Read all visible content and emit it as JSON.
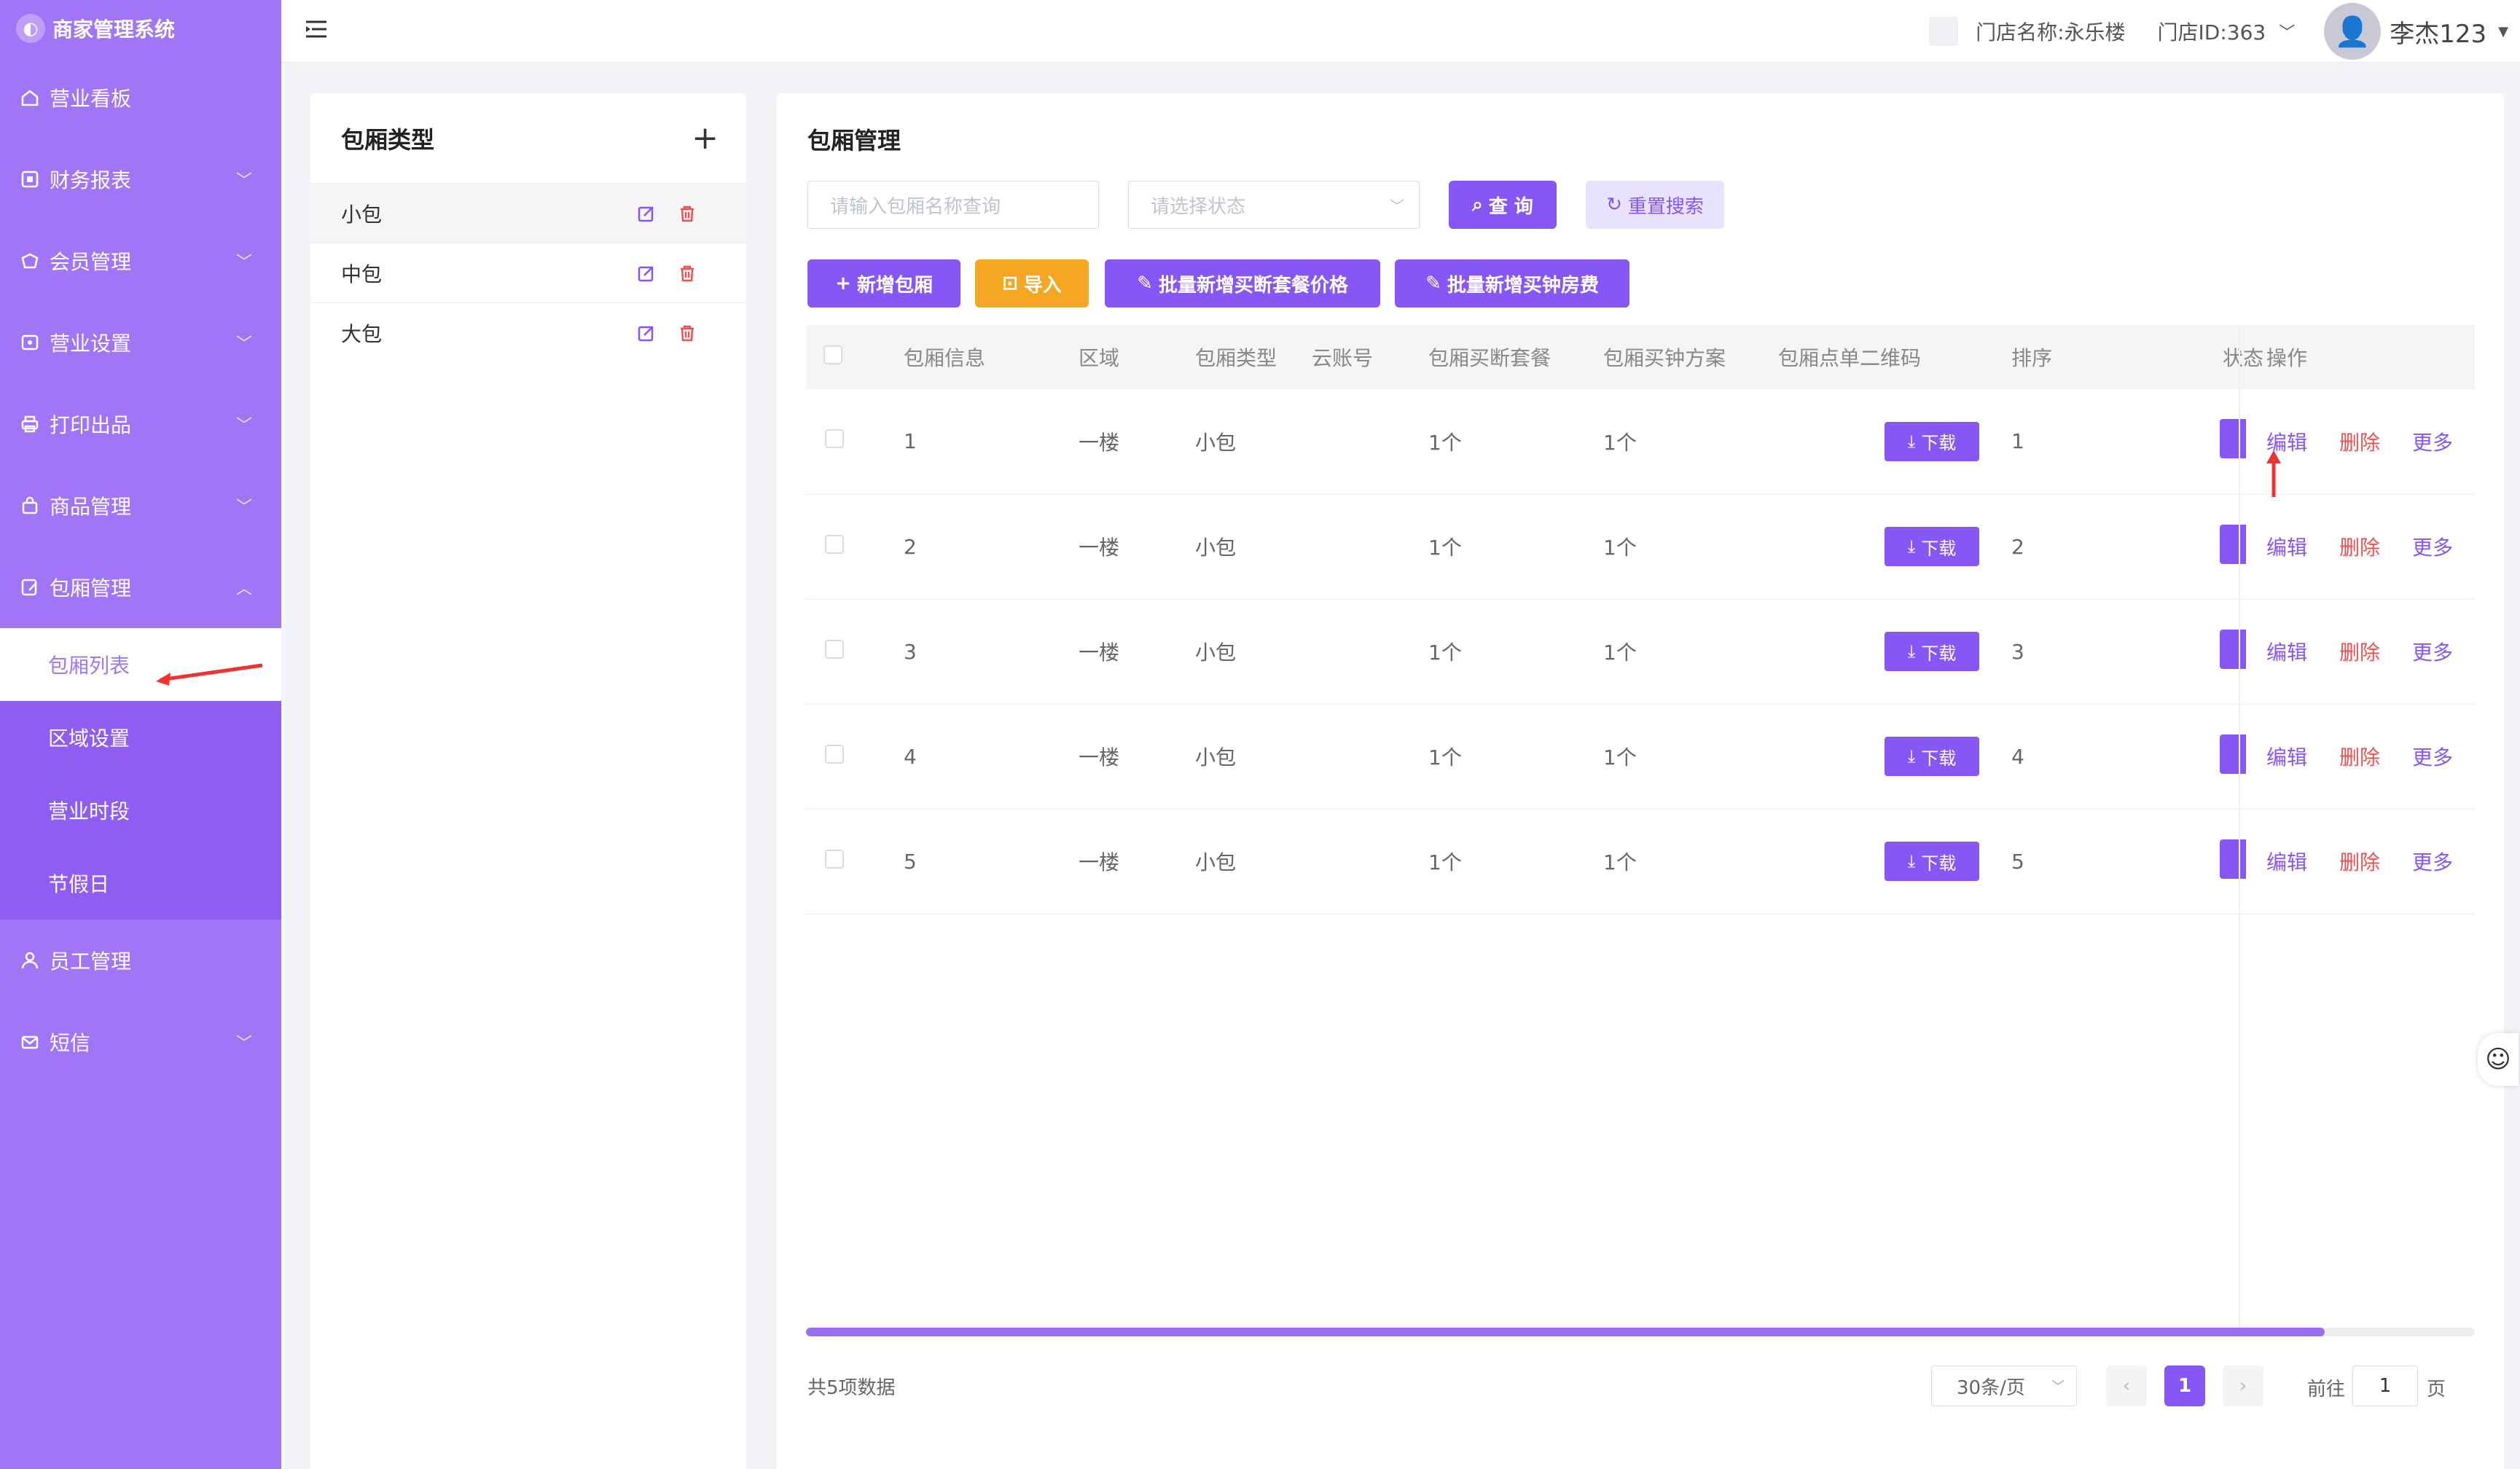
{
  "app": {
    "brand": "商家管理系统"
  },
  "sidebar": {
    "items": [
      {
        "label": "营业看板",
        "icon": "home-icon",
        "has_chevron": false
      },
      {
        "label": "财务报表",
        "icon": "report-icon",
        "has_chevron": true
      },
      {
        "label": "会员管理",
        "icon": "member-icon",
        "has_chevron": true
      },
      {
        "label": "营业设置",
        "icon": "settings-icon",
        "has_chevron": true
      },
      {
        "label": "打印出品",
        "icon": "printer-icon",
        "has_chevron": true
      },
      {
        "label": "商品管理",
        "icon": "bag-icon",
        "has_chevron": true
      },
      {
        "label": "包厢管理",
        "icon": "room-icon",
        "has_chevron": true,
        "expanded": true
      },
      {
        "label": "员工管理",
        "icon": "user-icon",
        "has_chevron": false
      },
      {
        "label": "短信",
        "icon": "mail-icon",
        "has_chevron": true
      }
    ],
    "submenu": [
      "包厢列表",
      "区域设置",
      "营业时段",
      "节假日"
    ],
    "active_sub": "包厢列表"
  },
  "topbar": {
    "store_name": "门店名称:永乐楼",
    "store_id": "门店ID:363",
    "user_name": "李杰123"
  },
  "left_panel": {
    "title": "包厢类型",
    "add_symbol": "+",
    "types": [
      "小包",
      "中包",
      "大包"
    ]
  },
  "main": {
    "title": "包厢管理",
    "search_placeholder": "请输入包厢名称查询",
    "status_placeholder": "请选择状态",
    "query_label": "查 询",
    "reset_label": "重置搜索",
    "add_label": "新增包厢",
    "import_label": "导入",
    "batch_price_label": "批量新增买断套餐价格",
    "batch_clock_label": "批量新增买钟房费",
    "columns": [
      "包厢信息",
      "区域",
      "包厢类型",
      "云账号",
      "包厢买断套餐",
      "包厢买钟方案",
      "包厢点单二维码",
      "排序",
      "状态",
      "操作"
    ],
    "rows": [
      {
        "info": "1",
        "area": "一楼",
        "type": "小包",
        "cloud": "",
        "buyout": "1个",
        "clock": "1个",
        "qr": "下载",
        "sort": "1"
      },
      {
        "info": "2",
        "area": "一楼",
        "type": "小包",
        "cloud": "",
        "buyout": "1个",
        "clock": "1个",
        "qr": "下载",
        "sort": "2"
      },
      {
        "info": "3",
        "area": "一楼",
        "type": "小包",
        "cloud": "",
        "buyout": "1个",
        "clock": "1个",
        "qr": "下载",
        "sort": "3"
      },
      {
        "info": "4",
        "area": "一楼",
        "type": "小包",
        "cloud": "",
        "buyout": "1个",
        "clock": "1个",
        "qr": "下载",
        "sort": "4"
      },
      {
        "info": "5",
        "area": "一楼",
        "type": "小包",
        "cloud": "",
        "buyout": "1个",
        "clock": "1个",
        "qr": "下载",
        "sort": "5"
      }
    ],
    "row_actions": {
      "edit": "编辑",
      "delete": "删除",
      "more": "更多"
    },
    "total_text": "共5项数据",
    "page_size": "30条/页",
    "current_page": "1",
    "goto_prefix": "前往",
    "goto_value": "1",
    "goto_suffix": "页",
    "horizontal_scroll": 0.91
  },
  "colors": {
    "sidebar": "#a176f6",
    "primary": "#8657f5",
    "warning": "#f5a623",
    "danger": "#f05050"
  }
}
